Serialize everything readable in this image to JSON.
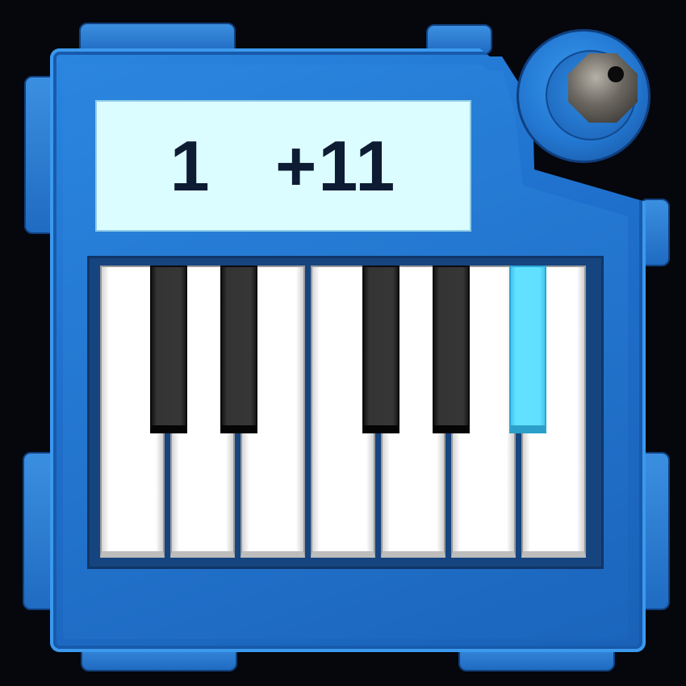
{
  "display": {
    "octave": "1",
    "transpose": "+11"
  },
  "keyboard": {
    "white_keys": 7,
    "black_keys": [
      "C#",
      "D#",
      "F#",
      "G#",
      "A#"
    ],
    "active_key": "A#",
    "active_color": "#62e0ff"
  },
  "colors": {
    "body": "#1f6fcb",
    "display_bg": "#dcfdff",
    "display_text": "#0d1b33"
  }
}
